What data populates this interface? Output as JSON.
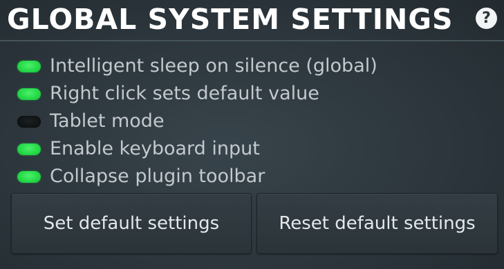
{
  "header": {
    "title": "GLOBAL SYSTEM SETTINGS",
    "help_label": "?",
    "help_icon": "help-icon"
  },
  "options": [
    {
      "label": "Intelligent sleep on silence (global)",
      "enabled": true
    },
    {
      "label": "Right click sets default value",
      "enabled": true
    },
    {
      "label": "Tablet mode",
      "enabled": false
    },
    {
      "label": "Enable keyboard input",
      "enabled": true
    },
    {
      "label": "Collapse plugin toolbar",
      "enabled": true
    }
  ],
  "buttons": {
    "set_default": "Set default settings",
    "reset_default": "Reset default settings"
  },
  "colors": {
    "led_on": "#23d846",
    "led_off": "#0d0f10",
    "background": "#2c363c",
    "title": "#ffffff"
  }
}
